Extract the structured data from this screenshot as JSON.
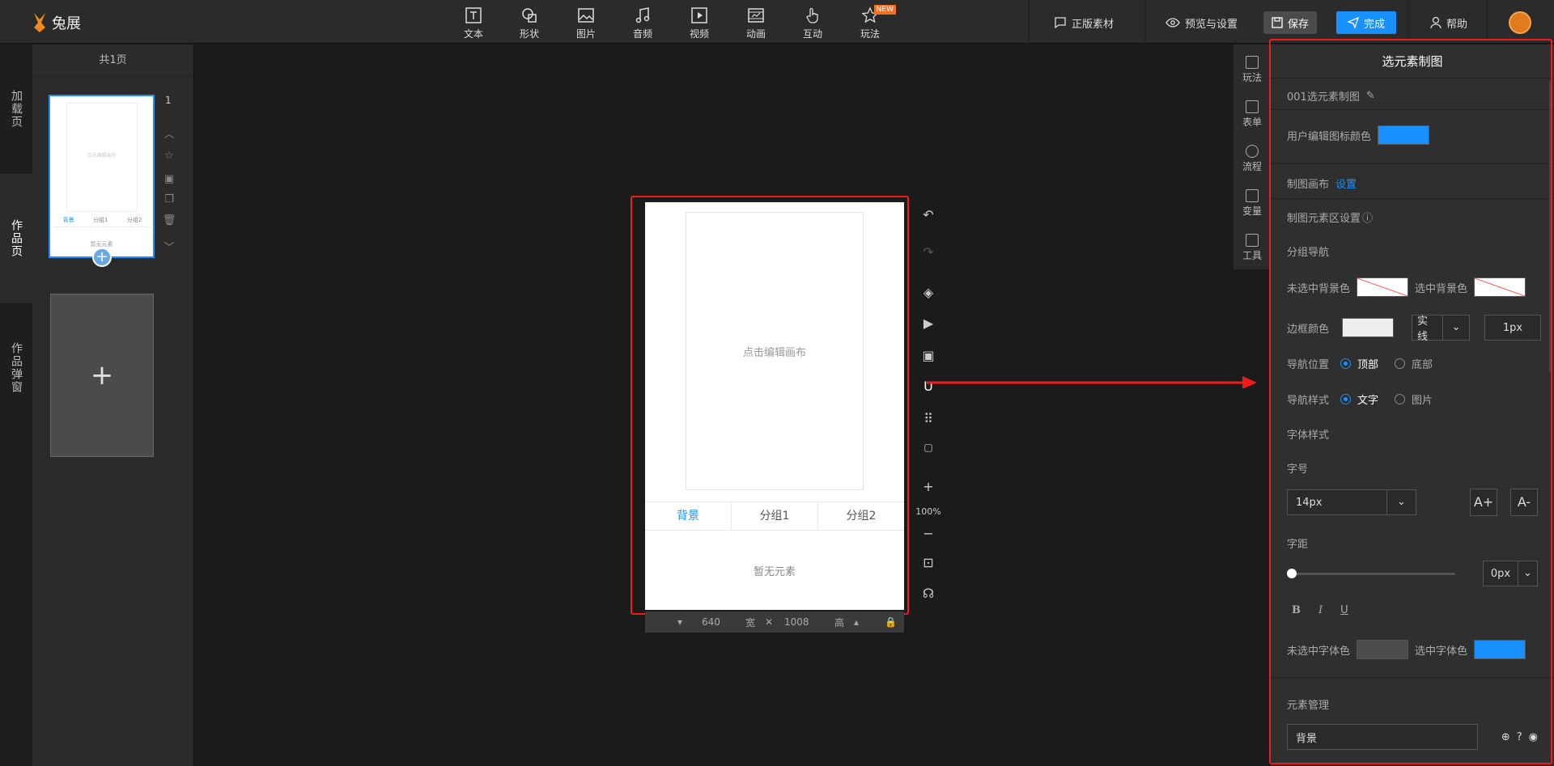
{
  "app": {
    "logo_text": "兔展"
  },
  "toolbar": {
    "tools": [
      {
        "label": "文本",
        "icon": "text-icon"
      },
      {
        "label": "形状",
        "icon": "shape-icon"
      },
      {
        "label": "图片",
        "icon": "image-icon"
      },
      {
        "label": "音频",
        "icon": "music-icon"
      },
      {
        "label": "视频",
        "icon": "video-icon"
      },
      {
        "label": "动画",
        "icon": "animation-icon"
      },
      {
        "label": "互动",
        "icon": "hand-icon"
      },
      {
        "label": "玩法",
        "icon": "star-icon",
        "badge": "NEW"
      }
    ],
    "licensed": "正版素材",
    "preview": "预览与设置",
    "save": "保存",
    "done": "完成",
    "help": "帮助"
  },
  "left_tabs": [
    "加载页",
    "作品页",
    "作品弹窗"
  ],
  "pages": {
    "header": "共1页",
    "page_number": "1",
    "thumb_canvas": "点击编辑画布",
    "thumb_nav": [
      "背景",
      "分组1",
      "分组2"
    ],
    "thumb_empty": "暂无元素"
  },
  "phone": {
    "canvas_hint": "点击编辑画布",
    "nav": [
      "背景",
      "分组1",
      "分组2"
    ],
    "empty": "暂无元素",
    "width": "640",
    "width_unit": "宽",
    "height": "1008",
    "height_unit": "高"
  },
  "canvas_tools": {
    "zoom": "100%"
  },
  "right_tabs": [
    "玩法",
    "表单",
    "流程",
    "变量",
    "工具"
  ],
  "panel": {
    "title": "选元素制图",
    "name": "001选元素制图",
    "icon_color_label": "用户编辑图标颜色",
    "icon_color": "#1890ff",
    "canvas_label": "制图画布",
    "canvas_link": "设置",
    "element_area_label": "制图元素区设置",
    "group_nav_label": "分组导航",
    "unselected_bg_label": "未选中背景色",
    "selected_bg_label": "选中背景色",
    "border_color_label": "边框颜色",
    "border_style": "实线",
    "border_width": "1px",
    "nav_position_label": "导航位置",
    "nav_position_options": [
      "顶部",
      "底部"
    ],
    "nav_style_label": "导航样式",
    "nav_style_options": [
      "文字",
      "图片"
    ],
    "font_style_label": "字体样式",
    "font_size_label": "字号",
    "font_size": "14px",
    "font_up": "A+",
    "font_down": "A-",
    "letter_spacing_label": "字距",
    "letter_spacing": "0px",
    "unselected_font_label": "未选中字体色",
    "selected_font_label": "选中字体色",
    "selected_font_color": "#1890ff",
    "element_mgmt_label": "元素管理",
    "element_item": "背景"
  }
}
